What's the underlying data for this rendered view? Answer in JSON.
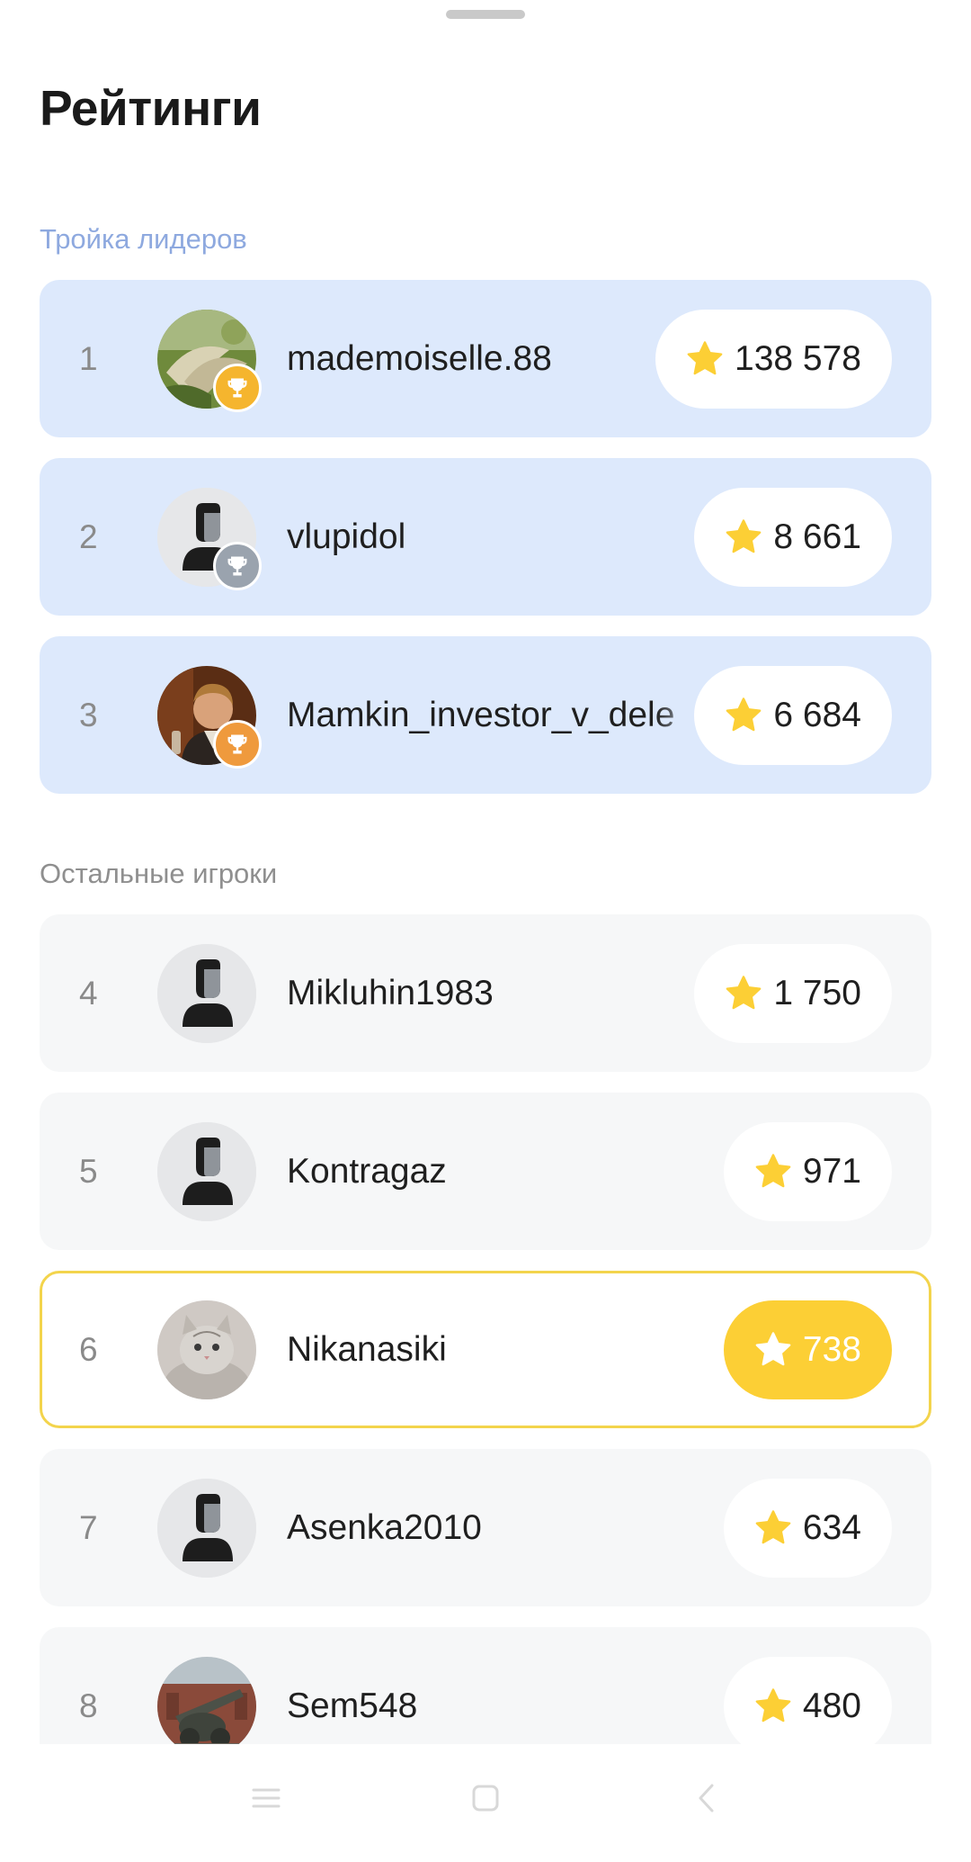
{
  "page": {
    "title": "Рейтинги"
  },
  "sections": {
    "leaders_label": "Тройка лидеров",
    "others_label": "Остальные игроки"
  },
  "colors": {
    "accent_yellow": "#fccf35",
    "leader_bg": "#dde9fc",
    "other_bg": "#f6f7f8",
    "gold": "#f5b52e",
    "silver": "#9aa3ae",
    "bronze": "#ef9a3d",
    "section_leaders": "#8ea9df"
  },
  "icons": {
    "star": "star-icon",
    "trophy": "trophy-icon",
    "default_avatar": "user-placeholder-icon",
    "nav_menu": "menu-icon",
    "nav_home": "home-square-icon",
    "nav_back": "back-chevron-icon"
  },
  "players": [
    {
      "rank": "1",
      "name": "mademoiselle.88",
      "score": "138 578",
      "trophy": "gold",
      "avatar": "photo-plant"
    },
    {
      "rank": "2",
      "name": "vlupidol",
      "score": "8 661",
      "trophy": "silver",
      "avatar": "default"
    },
    {
      "rank": "3",
      "name": "Mamkin_investor_v_dele",
      "score": "6 684",
      "trophy": "bronze",
      "avatar": "photo-man"
    },
    {
      "rank": "4",
      "name": "Mikluhin1983",
      "score": "1 750",
      "avatar": "default"
    },
    {
      "rank": "5",
      "name": "Kontragaz",
      "score": "971",
      "avatar": "default"
    },
    {
      "rank": "6",
      "name": "Nikanasiki",
      "score": "738",
      "avatar": "photo-cat",
      "current_user": true
    },
    {
      "rank": "7",
      "name": "Asenka2010",
      "score": "634",
      "avatar": "default"
    },
    {
      "rank": "8",
      "name": "Sem548",
      "score": "480",
      "avatar": "photo-cannon"
    }
  ]
}
